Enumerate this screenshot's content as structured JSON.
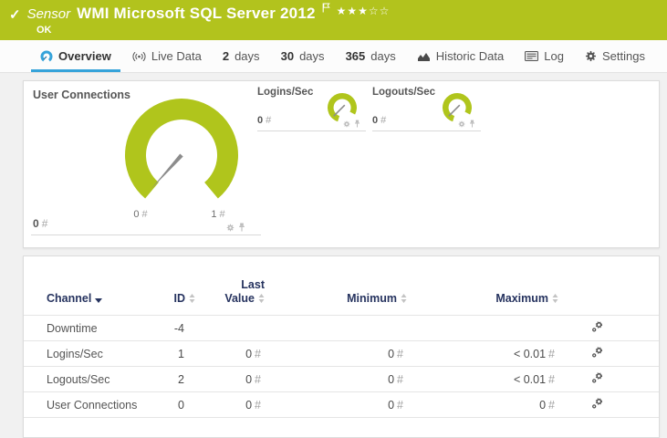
{
  "header": {
    "type_label": "Sensor",
    "title": "WMI Microsoft SQL Server 2012",
    "status": "OK",
    "rating": {
      "filled": 3,
      "total": 5
    }
  },
  "tabs": {
    "overview": {
      "label": "Overview",
      "active": true
    },
    "live_data": {
      "label": "Live Data"
    },
    "days2": {
      "strong": "2",
      "label": "days"
    },
    "days30": {
      "strong": "30",
      "label": "days"
    },
    "days365": {
      "strong": "365",
      "label": "days"
    },
    "historic": {
      "label": "Historic Data"
    },
    "log": {
      "label": "Log"
    },
    "settings": {
      "label": "Settings"
    }
  },
  "gauges": {
    "user_connections": {
      "title": "User Connections",
      "value": "0",
      "unit": "#",
      "scale_min_value": "0",
      "scale_min_unit": "#",
      "scale_max_value": "1",
      "scale_max_unit": "#",
      "range_min": 0,
      "range_max": 1,
      "needle_value": 0
    },
    "logins_per_sec": {
      "title": "Logins/Sec",
      "value": "0",
      "unit": "#",
      "needle_value": 0
    },
    "logouts_per_sec": {
      "title": "Logouts/Sec",
      "value": "0",
      "unit": "#",
      "needle_value": 0
    }
  },
  "table": {
    "headers": {
      "channel": "Channel",
      "id": "ID",
      "last_line1": "Last",
      "last_line2": "Value",
      "minimum": "Minimum",
      "maximum": "Maximum"
    },
    "rows": [
      {
        "channel": "Downtime",
        "id": "-4",
        "last_value": "",
        "last_unit": "",
        "minimum": "",
        "minimum_unit": "",
        "maximum": "",
        "maximum_unit": ""
      },
      {
        "channel": "Logins/Sec",
        "id": "1",
        "last_value": "0",
        "last_unit": "#",
        "minimum": "0",
        "minimum_unit": "#",
        "maximum": "< 0.01",
        "maximum_unit": "#"
      },
      {
        "channel": "Logouts/Sec",
        "id": "2",
        "last_value": "0",
        "last_unit": "#",
        "minimum": "0",
        "minimum_unit": "#",
        "maximum": "< 0.01",
        "maximum_unit": "#"
      },
      {
        "channel": "User Connections",
        "id": "0",
        "last_value": "0",
        "last_unit": "#",
        "minimum": "0",
        "minimum_unit": "#",
        "maximum": "0",
        "maximum_unit": "#"
      }
    ]
  },
  "colors": {
    "status_green": "#b2c31d",
    "gauge_green": "#b0c51c",
    "accent_blue": "#35a3da",
    "table_header_navy": "#26335f"
  }
}
